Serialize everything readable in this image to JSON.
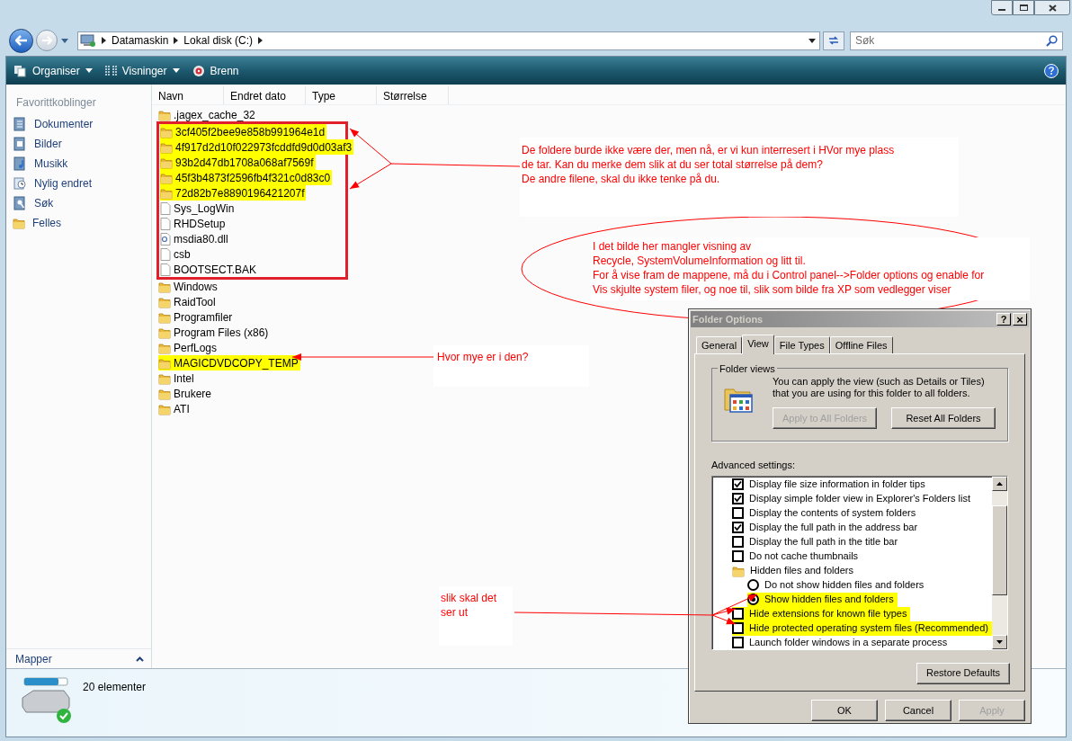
{
  "address": {
    "crumbs": [
      "Datamaskin",
      "Lokal disk (C:)"
    ]
  },
  "search": {
    "placeholder": "Søk"
  },
  "toolbar": [
    {
      "label": "Organiser",
      "kind": "menu"
    },
    {
      "label": "Visninger",
      "kind": "menu"
    },
    {
      "label": "Brenn",
      "kind": "button"
    }
  ],
  "sidebar": {
    "heading": "Favorittkoblinger",
    "items": [
      "Dokumenter",
      "Bilder",
      "Musikk",
      "Nylig endret",
      "Søk",
      "Felles"
    ],
    "footer": "Mapper"
  },
  "columns": [
    "Navn",
    "Endret dato",
    "Type",
    "Størrelse"
  ],
  "files": [
    {
      "name": ".jagex_cache_32",
      "kind": "folder",
      "highlighted": false
    },
    {
      "kind": "annotation_box",
      "children": [
        {
          "name": "3cf405f2bee9e858b991964e1d",
          "kind": "folder",
          "highlighted": true
        },
        {
          "name": "4f917d2d10f022973fcddfd9d0d03af3",
          "kind": "folder",
          "highlighted": true
        },
        {
          "name": "93b2d47db1708a068af7569f",
          "kind": "folder",
          "highlighted": true
        },
        {
          "name": "45f3b4873f2596fb4f321c0d83c0",
          "kind": "folder",
          "highlighted": true
        },
        {
          "name": "72d82b7e8890196421207f",
          "kind": "folder",
          "highlighted": true
        },
        {
          "name": "Sys_LogWin",
          "kind": "file",
          "highlighted": false
        },
        {
          "name": "RHDSetup",
          "kind": "file",
          "highlighted": false
        },
        {
          "name": "msdia80.dll",
          "kind": "dll",
          "highlighted": false
        },
        {
          "name": "csb",
          "kind": "file",
          "highlighted": false
        },
        {
          "name": "BOOTSECT.BAK",
          "kind": "file",
          "highlighted": false
        }
      ]
    },
    {
      "name": "Windows",
      "kind": "folder",
      "highlighted": false
    },
    {
      "name": "RaidTool",
      "kind": "folder",
      "highlighted": false
    },
    {
      "name": "Programfiler",
      "kind": "folder",
      "highlighted": false
    },
    {
      "name": "Program Files (x86)",
      "kind": "folder",
      "highlighted": false
    },
    {
      "name": "PerfLogs",
      "kind": "folder",
      "highlighted": false
    },
    {
      "name": "MAGICDVDCOPY_TEMP",
      "kind": "folder",
      "highlighted": true
    },
    {
      "name": "Intel",
      "kind": "folder",
      "highlighted": false
    },
    {
      "name": "Brukere",
      "kind": "folder",
      "highlighted": false
    },
    {
      "name": "ATI",
      "kind": "folder",
      "highlighted": false
    }
  ],
  "status": "20 elementer",
  "annotations": [
    "De foldere burde ikke være der, men nå, er vi kun interresert i HVor  mye plass\nde tar. Kan du merke dem slik at du ser total størrelse på dem?\nDe andre filene, skal du ikke tenke på du.",
    "I det bilde her mangler visning av\nRecycle, SystemVolumeInformation og litt til.\nFor å vise fram de mappene, må du i Control panel-->Folder options og enable for\nVis skjulte system filer, og noe til, slik som bilde fra XP som vedlegger viser",
    "Hvor mye er i den?",
    "slik skal det\nser ut"
  ],
  "dialog": {
    "title": "Folder Options",
    "help": "?",
    "close": "×",
    "tabs": [
      {
        "label": "General",
        "selected": false
      },
      {
        "label": "View",
        "selected": true
      },
      {
        "label": "File Types",
        "selected": false
      },
      {
        "label": "Offline Files",
        "selected": false
      }
    ],
    "group_title": "Folder views",
    "description": "You can apply the view (such as Details or Tiles) that you are using for this folder to all folders.",
    "group_buttons": [
      {
        "label": "Apply to All Folders",
        "disabled": true
      },
      {
        "label": "Reset All Folders",
        "disabled": false
      }
    ],
    "advanced_label": "Advanced settings:",
    "settings": [
      {
        "kind": "checkbox",
        "label": "Display file size information in folder tips",
        "checked": true,
        "highlighted": false
      },
      {
        "kind": "checkbox",
        "label": "Display simple folder view in Explorer's Folders list",
        "checked": true,
        "highlighted": false
      },
      {
        "kind": "checkbox",
        "label": "Display the contents of system folders",
        "checked": false,
        "highlighted": false
      },
      {
        "kind": "checkbox",
        "label": "Display the full path in the address bar",
        "checked": true,
        "highlighted": false
      },
      {
        "kind": "checkbox",
        "label": "Display the full path in the title bar",
        "checked": false,
        "highlighted": false
      },
      {
        "kind": "checkbox",
        "label": "Do not cache thumbnails",
        "checked": false,
        "highlighted": false
      },
      {
        "kind": "folder",
        "label": "Hidden files and folders",
        "highlighted": false
      },
      {
        "kind": "radio",
        "label": "Do not show hidden files and folders",
        "selected": false,
        "highlighted": false
      },
      {
        "kind": "radio",
        "label": "Show hidden files and folders",
        "selected": true,
        "highlighted": true
      },
      {
        "kind": "checkbox",
        "label": "Hide extensions for known file types",
        "checked": false,
        "highlighted": true
      },
      {
        "kind": "checkbox",
        "label": "Hide protected operating system files (Recommended)",
        "checked": false,
        "highlighted": true
      },
      {
        "kind": "checkbox",
        "label": "Launch folder windows in a separate process",
        "checked": false,
        "highlighted": false
      }
    ],
    "restore": {
      "label": "Restore Defaults",
      "disabled": false
    },
    "footer_buttons": [
      {
        "label": "OK",
        "disabled": false
      },
      {
        "label": "Cancel",
        "disabled": false
      },
      {
        "label": "Apply",
        "disabled": true
      }
    ]
  }
}
